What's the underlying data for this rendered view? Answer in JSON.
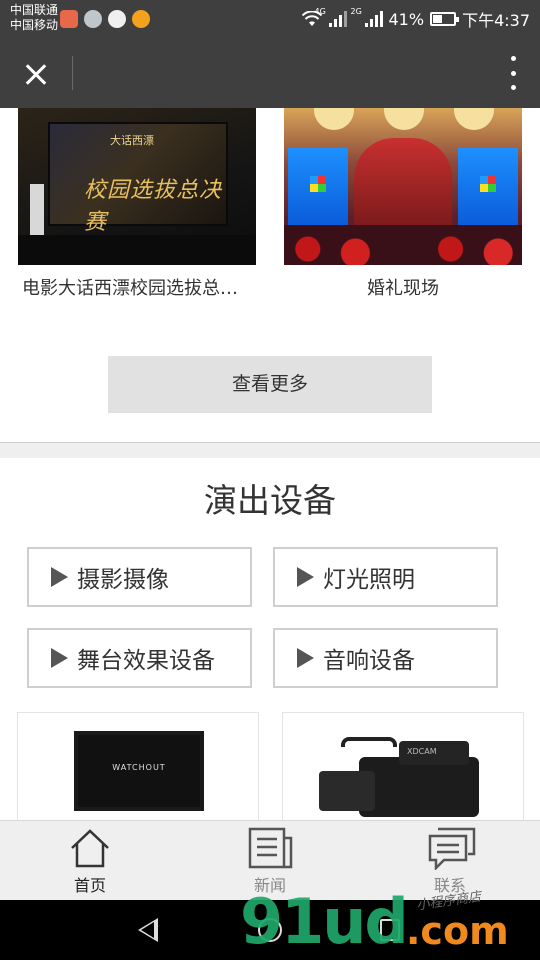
{
  "status_bar": {
    "carrier1": "中国联通",
    "carrier2": "中国移动",
    "net1": "4G",
    "net2": "2G",
    "battery": "41%",
    "time": "下午4:37"
  },
  "gallery": {
    "items": [
      {
        "caption": "电影大话西漂校园选拔总…",
        "screen_title": "校园选拔总决赛",
        "screen_logo": "大话西漂"
      },
      {
        "caption": "婚礼现场"
      }
    ]
  },
  "more_button": "查看更多",
  "section": {
    "title": "演出设备",
    "categories": [
      "摄影摄像",
      "灯光照明",
      "舞台效果设备",
      "音响设备"
    ]
  },
  "products": [
    {
      "screen_text": "WATCHOUT"
    },
    {
      "brand_text": "XDCAM"
    }
  ],
  "tabbar": {
    "items": [
      {
        "label": "首页",
        "icon": "home-icon",
        "active": true
      },
      {
        "label": "新闻",
        "icon": "news-icon",
        "active": false
      },
      {
        "label": "联系",
        "icon": "chat-icon",
        "active": false
      }
    ]
  },
  "watermark": {
    "text": "91ud",
    "suffix": ".com",
    "tagline": "小程序商店"
  },
  "colors": {
    "bar": "#3f3f3f",
    "button_bg": "#e1e1e1",
    "watermark_green": "#1fa86a",
    "watermark_orange": "#f08a1e"
  }
}
